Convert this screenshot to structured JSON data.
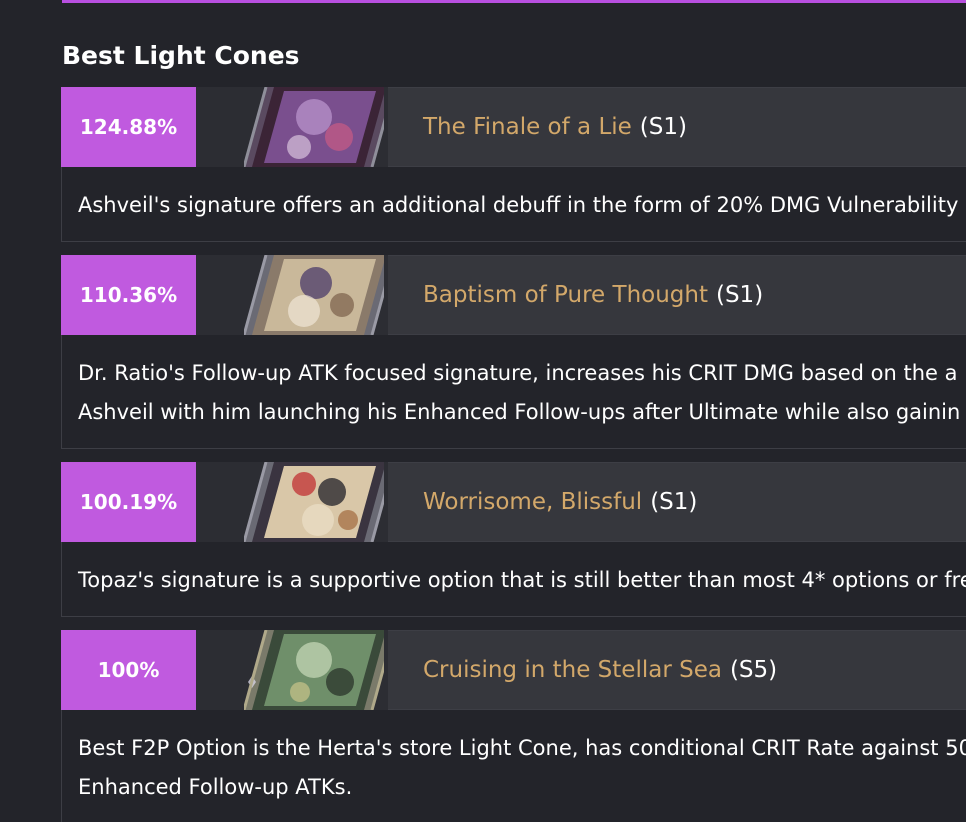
{
  "section": {
    "title": "Best Light Cones"
  },
  "colors": {
    "accent": "#c05adf",
    "gold": "#d3a86a",
    "background": "#23242a",
    "header_bg": "#36373d"
  },
  "cones": [
    {
      "rank": "124.88%",
      "name": "The Finale of a Lie",
      "tier": "(S1)",
      "art_icon": "light-cone-art-finale-of-a-lie",
      "desc_lines": [
        "Ashveil's signature offers an additional debuff in the form of 20% DMG Vulnerability"
      ]
    },
    {
      "rank": "110.36%",
      "name": "Baptism of Pure Thought",
      "tier": "(S1)",
      "art_icon": "light-cone-art-baptism-of-pure-thought",
      "desc_lines": [
        "Dr. Ratio's Follow-up ATK focused signature, increases his CRIT DMG based on the a",
        "Ashveil with him launching his Enhanced Follow-ups after Ultimate while also gainin"
      ]
    },
    {
      "rank": "100.19%",
      "name": "Worrisome, Blissful",
      "tier": "(S1)",
      "art_icon": "light-cone-art-worrisome-blissful",
      "desc_lines": [
        "Topaz's signature is a supportive option that is still better than most 4* options or fre"
      ]
    },
    {
      "rank": "100%",
      "name": "Cruising in the Stellar Sea",
      "tier": "(S5)",
      "art_icon": "light-cone-art-cruising-in-the-stellar-sea",
      "desc_lines": [
        "Best F2P Option is the Herta's store Light Cone, has conditional CRIT Rate against 50",
        "Enhanced Follow-up ATKs."
      ]
    }
  ]
}
